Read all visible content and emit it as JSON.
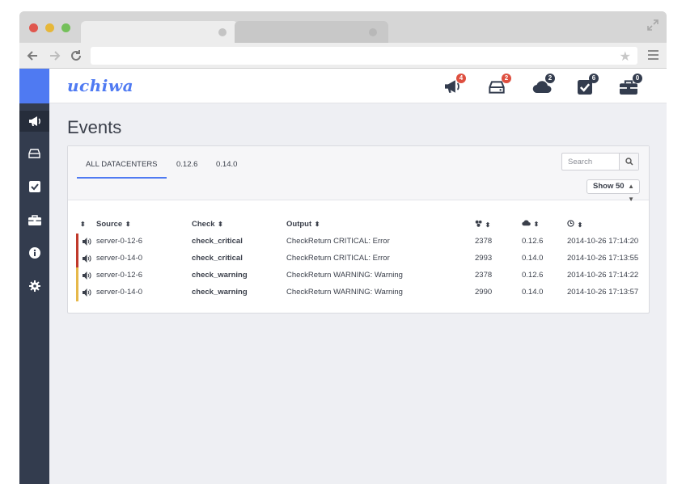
{
  "app": {
    "logo": "uchiwa",
    "colors": {
      "accent": "#4f7af2",
      "sidebar": "#333c4e",
      "critical": "#c0392b",
      "warning": "#e6b84a"
    }
  },
  "header": {
    "icons": [
      {
        "name": "megaphone-icon",
        "badge": "4",
        "badge_color": "red"
      },
      {
        "name": "server-icon",
        "badge": "2",
        "badge_color": "red"
      },
      {
        "name": "cloud-icon",
        "badge": "2",
        "badge_color": "dark"
      },
      {
        "name": "checkbox-icon",
        "badge": "6",
        "badge_color": "dark"
      },
      {
        "name": "toolbox-icon",
        "badge": "0",
        "badge_color": "dark"
      }
    ]
  },
  "sidebar": {
    "items": [
      {
        "name": "megaphone-icon",
        "active": true
      },
      {
        "name": "server-icon",
        "active": false
      },
      {
        "name": "checkbox-icon",
        "active": false
      },
      {
        "name": "toolbox-icon",
        "active": false
      },
      {
        "name": "info-icon",
        "active": false
      },
      {
        "name": "gear-icon",
        "active": false
      }
    ]
  },
  "page": {
    "title": "Events"
  },
  "filters": {
    "tabs": [
      "ALL DATACENTERS",
      "0.12.6",
      "0.14.0"
    ],
    "active_tab": 0,
    "search_placeholder": "Search",
    "show_label": "Show 50"
  },
  "table": {
    "headers": {
      "source": "Source",
      "check": "Check",
      "output": "Output"
    },
    "header_icons": [
      "sort-icon",
      "cluster-icon",
      "cloud-icon",
      "clock-icon"
    ],
    "rows": [
      {
        "status": "critical",
        "source": "server-0-12-6",
        "check": "check_critical",
        "output": "CheckReturn CRITICAL: Error",
        "occurrences": "2378",
        "datacenter": "0.12.6",
        "timestamp": "2014-10-26 17:14:20"
      },
      {
        "status": "critical",
        "source": "server-0-14-0",
        "check": "check_critical",
        "output": "CheckReturn CRITICAL: Error",
        "occurrences": "2993",
        "datacenter": "0.14.0",
        "timestamp": "2014-10-26 17:13:55"
      },
      {
        "status": "warning",
        "source": "server-0-12-6",
        "check": "check_warning",
        "output": "CheckReturn WARNING: Warning",
        "occurrences": "2378",
        "datacenter": "0.12.6",
        "timestamp": "2014-10-26 17:14:22"
      },
      {
        "status": "warning",
        "source": "server-0-14-0",
        "check": "check_warning",
        "output": "CheckReturn WARNING: Warning",
        "occurrences": "2990",
        "datacenter": "0.14.0",
        "timestamp": "2014-10-26 17:13:57"
      }
    ]
  }
}
